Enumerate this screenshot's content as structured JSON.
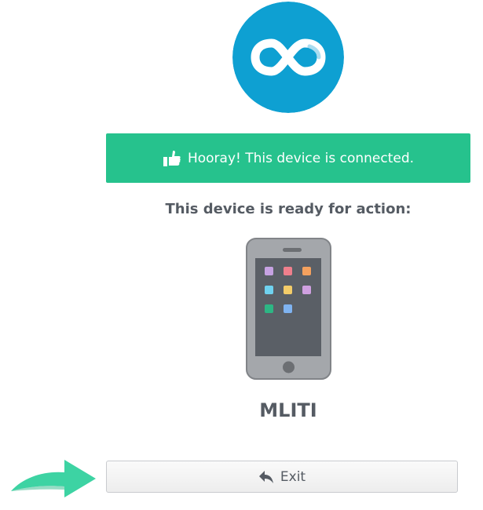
{
  "logo": {
    "icon": "infinity-logo-icon",
    "background_color": "#0ea0d2"
  },
  "status": {
    "message": "Hooray! This device is connected.",
    "icon": "thumbs-up-icon",
    "color": "#26c28d"
  },
  "device_section": {
    "heading": "This device is ready for action:",
    "device_icon": "smartphone-icon",
    "device_name": "MLITI"
  },
  "actions": {
    "exit_label": "Exit",
    "exit_icon": "reply-icon",
    "pointer_icon": "green-arrow-icon",
    "pointer_color": "#3dd3a3"
  }
}
